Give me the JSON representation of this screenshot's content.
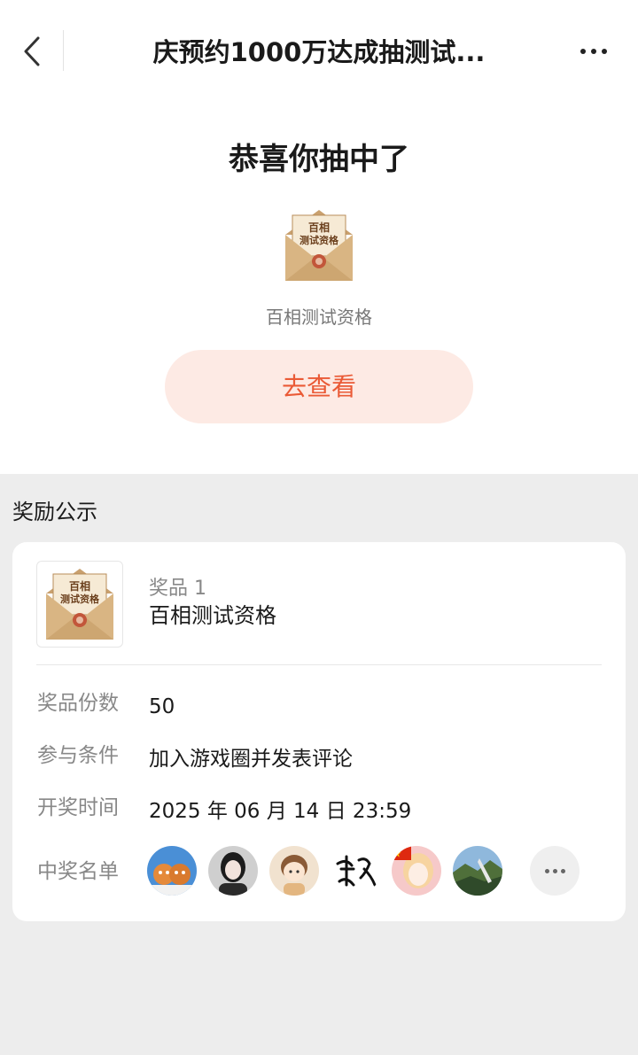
{
  "nav": {
    "title": "庆预约1000万达成抽测试..."
  },
  "result": {
    "congrats": "恭喜你抽中了",
    "prize_name": "百相测试资格",
    "view_button": "去查看",
    "envelope_text": "百相测试资格"
  },
  "section": {
    "title": "奖励公示"
  },
  "prize_card": {
    "index_label": "奖品 1",
    "name": "百相测试资格",
    "rows": [
      {
        "label": "奖品份数",
        "value": "50"
      },
      {
        "label": "参与条件",
        "value": "加入游戏圈并发表评论"
      },
      {
        "label": "开奖时间",
        "value": "2025 年 06 月 14 日 23:59"
      }
    ],
    "winners_label": "中奖名单",
    "winners": [
      {
        "icon": "cartoon-cats-avatar",
        "color": "#4a8fd6"
      },
      {
        "icon": "girl-photo-avatar",
        "color": "#cfcfcf"
      },
      {
        "icon": "chibi-boy-avatar",
        "color": "#f1e2cf"
      },
      {
        "icon": "calligraphy-avatar",
        "color": "#ffffff"
      },
      {
        "icon": "anime-girl-flag-avatar",
        "color": "#f6c9c9"
      },
      {
        "icon": "landscape-photo-avatar",
        "color": "#5f8fb8"
      }
    ]
  }
}
